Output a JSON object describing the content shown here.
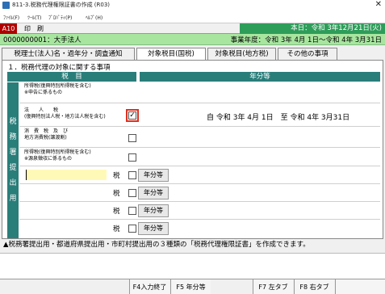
{
  "window": {
    "title": "811-3.税務代理権限証書の作成 (R03)",
    "close_glyph": "✕"
  },
  "menu": [
    "ﾌｧｲﾙ(F)",
    "ﾂｰﾙ(T)",
    "ﾌﾟﾛﾊﾟﾃｨ(P)",
    "ﾍﾙﾌﾟ(H)"
  ],
  "toolbar": {
    "code": "A10",
    "print_label": "印　刷",
    "date": "本日：令和 3年12月21日(火)"
  },
  "infobar": {
    "client": "0000000001：大手法人",
    "period": "事業年度：令和 3年 4月 1日～令和 4年 3月31日"
  },
  "tabs": [
    "税理士(法人)名・過年分・調査通知",
    "対象税目(国税)",
    "対象税目(地方税)",
    "その他の事項"
  ],
  "active_tab": 1,
  "section": {
    "title": "１．税務代理の対象に関する事項",
    "col_zeimoku": "税　目",
    "col_nenbun": "年分等",
    "side_label": "税務署提出用"
  },
  "rows": {
    "r1": {
      "label1": "所得税(復興特別所得税を含む)",
      "label2": "※申告に係るもの"
    },
    "r2": {
      "label1": "法　　人　　税",
      "label2": "(復興特別法人税・地方法人税を含む)",
      "checkbox": "✓",
      "period": "自 令和 3年 4月 1日　至 令和 4年 3月31日"
    },
    "r3": {
      "label1": "消　費　税　及　び",
      "label2": "地方消費税(譲渡割)"
    },
    "r4": {
      "label1": "所得税(復興特別所得税を含む)",
      "label2": "※源泉徴収に係るもの"
    },
    "blank_suffix": "税",
    "nenbun_btn": "年分等"
  },
  "notice": "▲税務署提出用・都道府県提出用・市町村提出用の３種類の「税務代理権限証書」を作成できます。",
  "fkeys": {
    "f4": "F4入力終了",
    "f5": "F5 年分等",
    "f7": "F7 左タブ",
    "f8": "F8 右タブ"
  }
}
